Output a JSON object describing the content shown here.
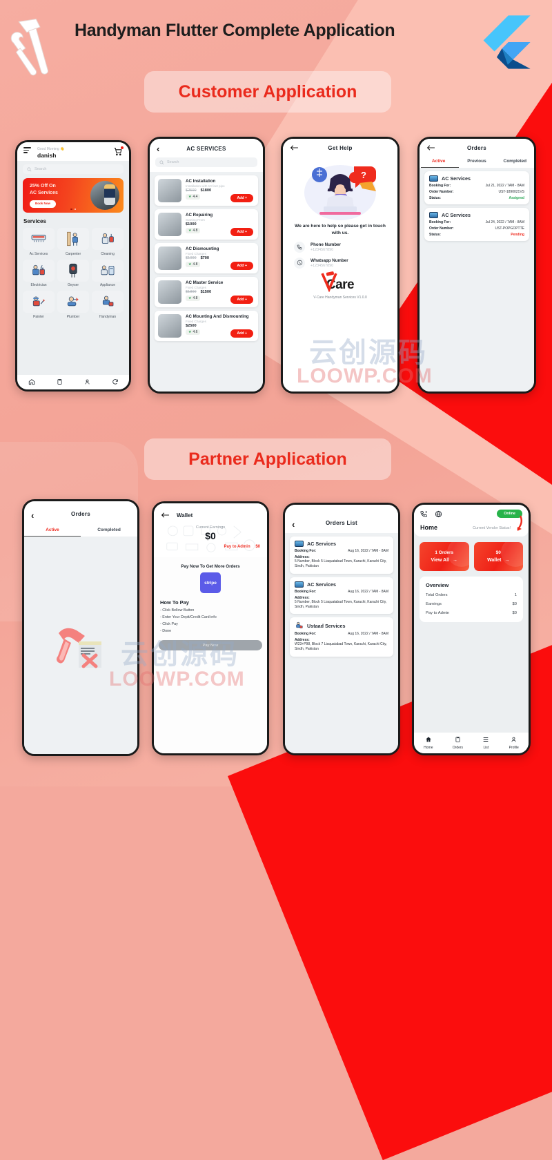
{
  "header": {
    "title": "Handyman Flutter Complete Application",
    "hammer_icon": "hammer-wrench-icon",
    "flutter_icon": "flutter-logo-icon"
  },
  "sections": {
    "customer_label": "Customer Application",
    "partner_label": "Partner Application"
  },
  "watermarks": {
    "cn_text": "云创源码",
    "site_text": "LOOWP.COM"
  },
  "customer": {
    "home": {
      "menu_icon": "hamburger-menu-icon",
      "greeting": "Good Morning 👋",
      "user_name": "danish",
      "cart_icon": "shopping-cart-icon",
      "search_placeholder": "Search",
      "search_icon": "search-icon",
      "promo": {
        "line1": "25% Off On",
        "line2": "AC Services",
        "button": "Book Now"
      },
      "services_title": "Services",
      "services": [
        {
          "label": "Ac Services",
          "icon": "air-conditioner-icon"
        },
        {
          "label": "Carpenter",
          "icon": "carpenter-icon"
        },
        {
          "label": "Cleaning",
          "icon": "cleaning-icon"
        },
        {
          "label": "Electrician",
          "icon": "electrician-icon"
        },
        {
          "label": "Geyser",
          "icon": "geyser-icon"
        },
        {
          "label": "Appliance",
          "icon": "appliance-icon"
        },
        {
          "label": "Painter",
          "icon": "painter-icon"
        },
        {
          "label": "Plumber",
          "icon": "plumber-icon"
        },
        {
          "label": "Handyman",
          "icon": "handyman-icon"
        }
      ],
      "nav": [
        {
          "icon": "home-icon"
        },
        {
          "icon": "clipboard-icon"
        },
        {
          "icon": "person-icon"
        },
        {
          "icon": "refresh-icon"
        }
      ]
    },
    "ac_services": {
      "back_icon": "back-chevron-icon",
      "title": "AC SERVICES",
      "search_placeholder": "Search",
      "add_label": "Add +",
      "items": [
        {
          "name": "AC Installation",
          "sub": "Installation with 10 feet pipe",
          "old_price": "$2500",
          "price": "$1800",
          "rating": "4.4"
        },
        {
          "name": "AC Repairing",
          "sub": "Starting From",
          "old_price": "",
          "price": "$1000",
          "rating": "4.8"
        },
        {
          "name": "AC Dismounting",
          "sub": "Fixed Charges",
          "old_price": "$1000",
          "price": "$700",
          "rating": "4.8"
        },
        {
          "name": "AC Master Service",
          "sub": "Fixed Charges",
          "old_price": "$1800",
          "price": "$1500",
          "rating": "4.8"
        },
        {
          "name": "AC Mounting And Dismounting",
          "sub": "Fixed Charges",
          "old_price": "",
          "price": "$2500",
          "rating": "4.6"
        }
      ]
    },
    "get_help": {
      "back_icon": "back-arrow-icon",
      "title": "Get Help",
      "illustration": "support-agent-illustration",
      "headline": "We are here to help so please get in touch with us.",
      "contacts": [
        {
          "icon": "phone-icon",
          "label": "Phone Number",
          "value": "+1234567890"
        },
        {
          "icon": "whatsapp-icon",
          "label": "Whatsapp Number",
          "value": "+1234567890"
        }
      ],
      "brand": "Care",
      "brand_prefix": "V",
      "version": "V-Care Handyman Services V1.0.0"
    },
    "orders": {
      "back_icon": "back-arrow-icon",
      "title": "Orders",
      "tabs": [
        "Active",
        "Previous",
        "Completed"
      ],
      "active_tab": "Active",
      "labels": {
        "booking": "Booking For:",
        "order": "Order Number:",
        "status": "Status:"
      },
      "items": [
        {
          "icon": "air-conditioner-icon",
          "service": "AC Services",
          "booking": "Jul 21, 2022 / 7AM - 8AM",
          "order_number": "UST-1890021VS",
          "status": "Assigned",
          "status_type": "assigned"
        },
        {
          "icon": "air-conditioner-icon",
          "service": "AC Services",
          "booking": "Jul 24, 2022 / 7AM - 8AM",
          "order_number": "UST-POPGOPTTE",
          "status": "Pending",
          "status_type": "pending"
        }
      ]
    }
  },
  "partner": {
    "orders": {
      "back_icon": "back-chevron-icon",
      "title": "Orders",
      "tabs": [
        "Active",
        "Completed"
      ],
      "active_tab": "Active",
      "empty_illustration": "hammer-no-orders-illustration"
    },
    "wallet": {
      "back_icon": "back-arrow-icon",
      "title": "Wallet",
      "earnings_label": "Current Earnings",
      "earnings_value": "$0",
      "pay_to_admin_label": "Pay to Admin",
      "pay_to_admin_value": "$0",
      "cta": "Pay Now To Get More Orders",
      "stripe_label": "stripe",
      "how_to_pay_title": "How To Pay",
      "steps": [
        "- Click Bellow Button",
        "- Enter Your Depit/Credit Card info",
        "- Click Pay",
        "- Done"
      ],
      "pay_button": "Pay Now"
    },
    "orders_list": {
      "back_icon": "back-chevron-icon",
      "title": "Orders List",
      "labels": {
        "booking": "Booking For:",
        "address": "Address:"
      },
      "items": [
        {
          "icon": "air-conditioner-icon",
          "service": "AC Services",
          "booking": "Aug 16, 2022 / 7AM - 8AM",
          "address": "5 Number, Block 5 Liaquatabad Town, Karachi, Karachi City, Sindh, Pakistan"
        },
        {
          "icon": "air-conditioner-icon",
          "service": "AC Services",
          "booking": "Aug 16, 2022 / 7AM - 8AM",
          "address": "5 Number, Block 5 Liaquatabad Town, Karachi, Karachi City, Sindh, Pakistan"
        },
        {
          "icon": "handyman-icon",
          "service": "Ustaad Services",
          "booking": "Aug 16, 2022 / 7AM - 8AM",
          "address": "W23+P98, Block 7 Liaquatabad Town, Karachi, Karachi City, Sindh, Pakistan"
        }
      ]
    },
    "home": {
      "call_icon": "phone-call-icon",
      "globe_icon": "globe-icon",
      "online_badge": "Online",
      "title": "Home",
      "vendor_status_label": "Current Vendor Status!",
      "arrow_icon": "curved-arrow-icon",
      "kpis": [
        {
          "value": "1 Orders",
          "label": "View All",
          "arrow": "→"
        },
        {
          "value": "$0",
          "label": "Wallet",
          "arrow": "→"
        }
      ],
      "overview_title": "Overview",
      "overview": [
        {
          "label": "Total Orders",
          "value": "1"
        },
        {
          "label": "Earnings",
          "value": "$0"
        },
        {
          "label": "Pay to Admin",
          "value": "$0"
        }
      ],
      "nav": [
        {
          "label": "Home",
          "icon": "home-icon"
        },
        {
          "label": "Orders",
          "icon": "clipboard-icon"
        },
        {
          "label": "List",
          "icon": "list-icon"
        },
        {
          "label": "Profile",
          "icon": "person-icon"
        }
      ]
    }
  },
  "colors": {
    "background": "#f4a99d",
    "accent_red": "#ef2b1d",
    "bright_red": "#fb0d0d",
    "green": "#27b34a",
    "pill_bg": "#ffffff66"
  }
}
